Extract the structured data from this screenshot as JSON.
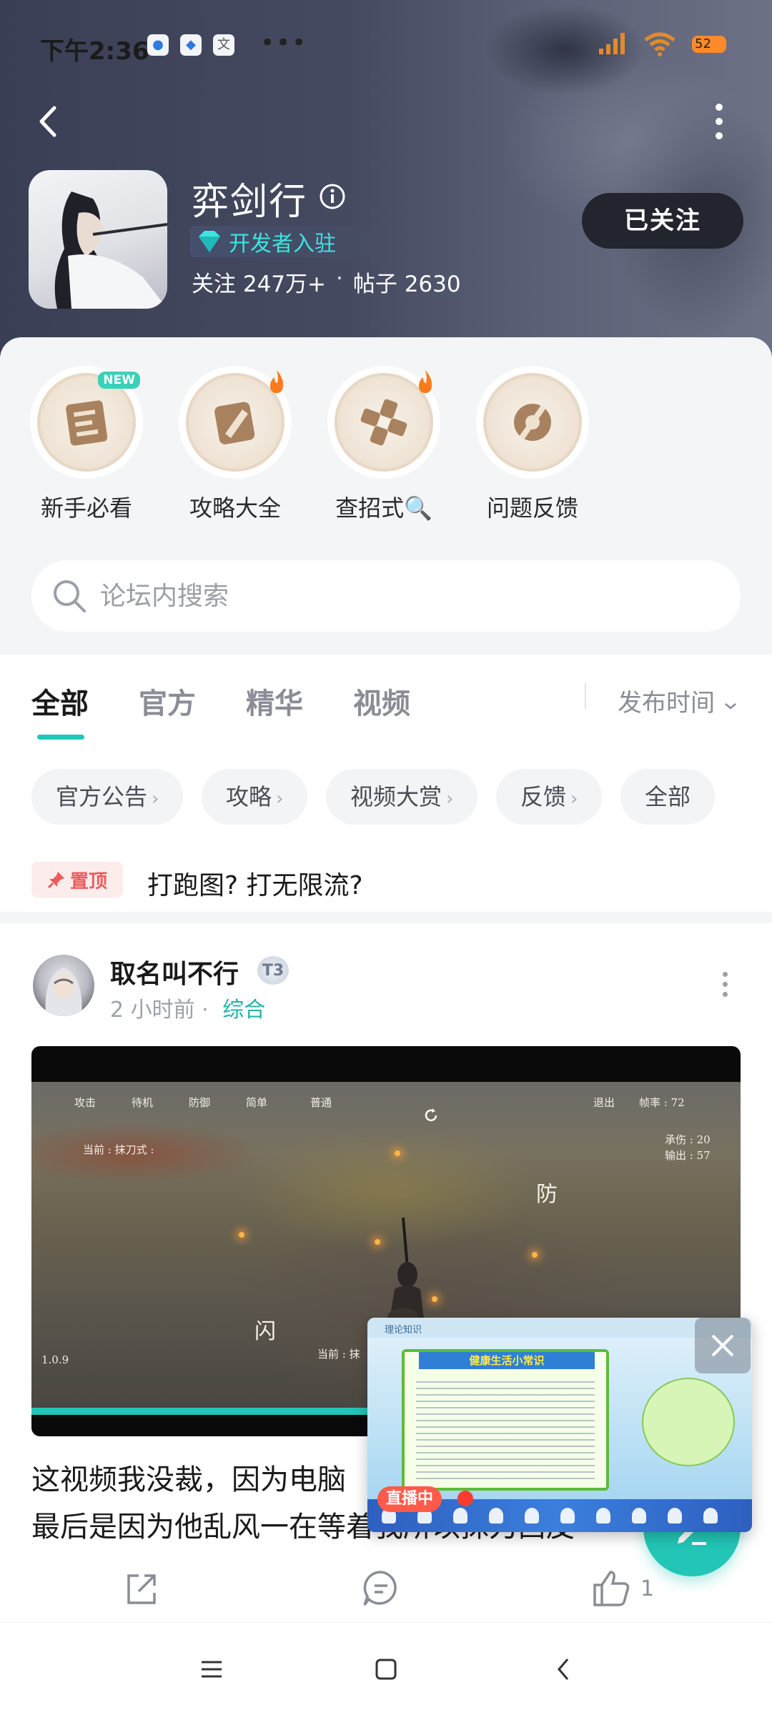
{
  "status_bar": {
    "time": "下午2:36",
    "apps": [
      "QQ",
      "相册",
      "翻译"
    ],
    "dots": "•••",
    "battery": "52"
  },
  "header": {
    "game_title": "弈剑行",
    "dev_badge": "开发者入驻",
    "followers_label": "关注 247万+",
    "separator": "·",
    "posts_label": "帖子 2630",
    "follow_button": "已关注"
  },
  "quick_entries": [
    {
      "label": "新手必看",
      "icon": "guide-icon",
      "tag": "NEW"
    },
    {
      "label": "攻略大全",
      "icon": "strategy-icon",
      "tag": "fire"
    },
    {
      "label": "查招式🔍",
      "icon": "controller-icon",
      "tag": "fire"
    },
    {
      "label": "问题反馈",
      "icon": "wrench-icon",
      "tag": ""
    }
  ],
  "search": {
    "placeholder": "论坛内搜索"
  },
  "tabs": {
    "items": [
      "全部",
      "官方",
      "精华",
      "视频"
    ],
    "active": "全部",
    "sort_label": "发布时间"
  },
  "chips": [
    {
      "label": "官方公告",
      "arrow": "›"
    },
    {
      "label": "攻略",
      "arrow": "›"
    },
    {
      "label": "视频大赏",
      "arrow": "›"
    },
    {
      "label": "反馈",
      "arrow": "›"
    },
    {
      "label": "全部",
      "arrow": ""
    }
  ],
  "pinned": {
    "badge": "置顶",
    "title": "打跑图? 打无限流?"
  },
  "post": {
    "author": "取名叫不行",
    "level": "T3",
    "time": "2 小时前",
    "dot": "·",
    "category": "综合",
    "title_line1": "这视频我没裁，因为电脑",
    "title_line2": "最后是因为他乱风一在等着我所以抹刀西皮",
    "video": {
      "progress": 0.78,
      "hud_top": [
        "攻击",
        "待机",
        "防御",
        "简单",
        "普通"
      ],
      "hud_right_top": [
        "退出",
        "帧率 : 72"
      ],
      "hud_stats": [
        "承伤 : 20",
        "输出 : 57"
      ],
      "hud_current": "当前 : 抹刀式 :",
      "hud_version": "1.0.9",
      "hud_defend": "防",
      "hud_dodge": "闪",
      "hud_bottom": "当前 : 抹"
    },
    "likes": "1"
  },
  "live_window": {
    "header_text": "理论知识",
    "board_title": "健康生活小常识",
    "live_badge": "直播中"
  },
  "colors": {
    "accent": "#20c6b8",
    "header_bg": "#454a60",
    "pin_red": "#ef5b5b",
    "live_red": "#ff5a4a"
  }
}
